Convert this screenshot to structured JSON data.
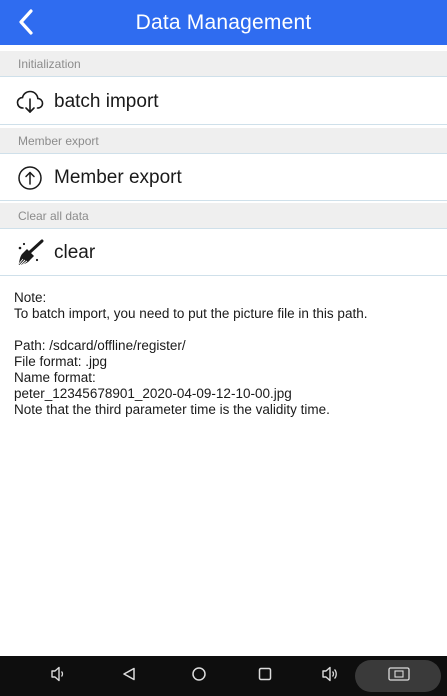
{
  "header": {
    "title": "Data Management",
    "color": "#2f6cf0"
  },
  "sections": [
    {
      "label": "Initialization",
      "item": {
        "label": "batch import",
        "icon": "cloud-download-icon"
      }
    },
    {
      "label": "Member export",
      "item": {
        "label": "Member export",
        "icon": "arrow-up-circle-icon"
      }
    },
    {
      "label": "Clear all data",
      "item": {
        "label": "clear",
        "icon": "broom-icon"
      }
    }
  ],
  "notes": {
    "heading": "Note:",
    "line1": "To batch import, you need to put the picture file in this path.",
    "path": "Path: /sdcard/offline/register/",
    "file_format": "File format: .jpg",
    "name_format": "Name format:",
    "example": "peter_12345678901_2020-04-09-12-10-00.jpg",
    "validity": "Note that the third parameter time is the validity time."
  },
  "navbar": {
    "icons": [
      "volume-down-icon",
      "back-triangle-icon",
      "home-circle-icon",
      "recents-square-icon",
      "volume-up-icon",
      "screenshot-icon"
    ]
  }
}
